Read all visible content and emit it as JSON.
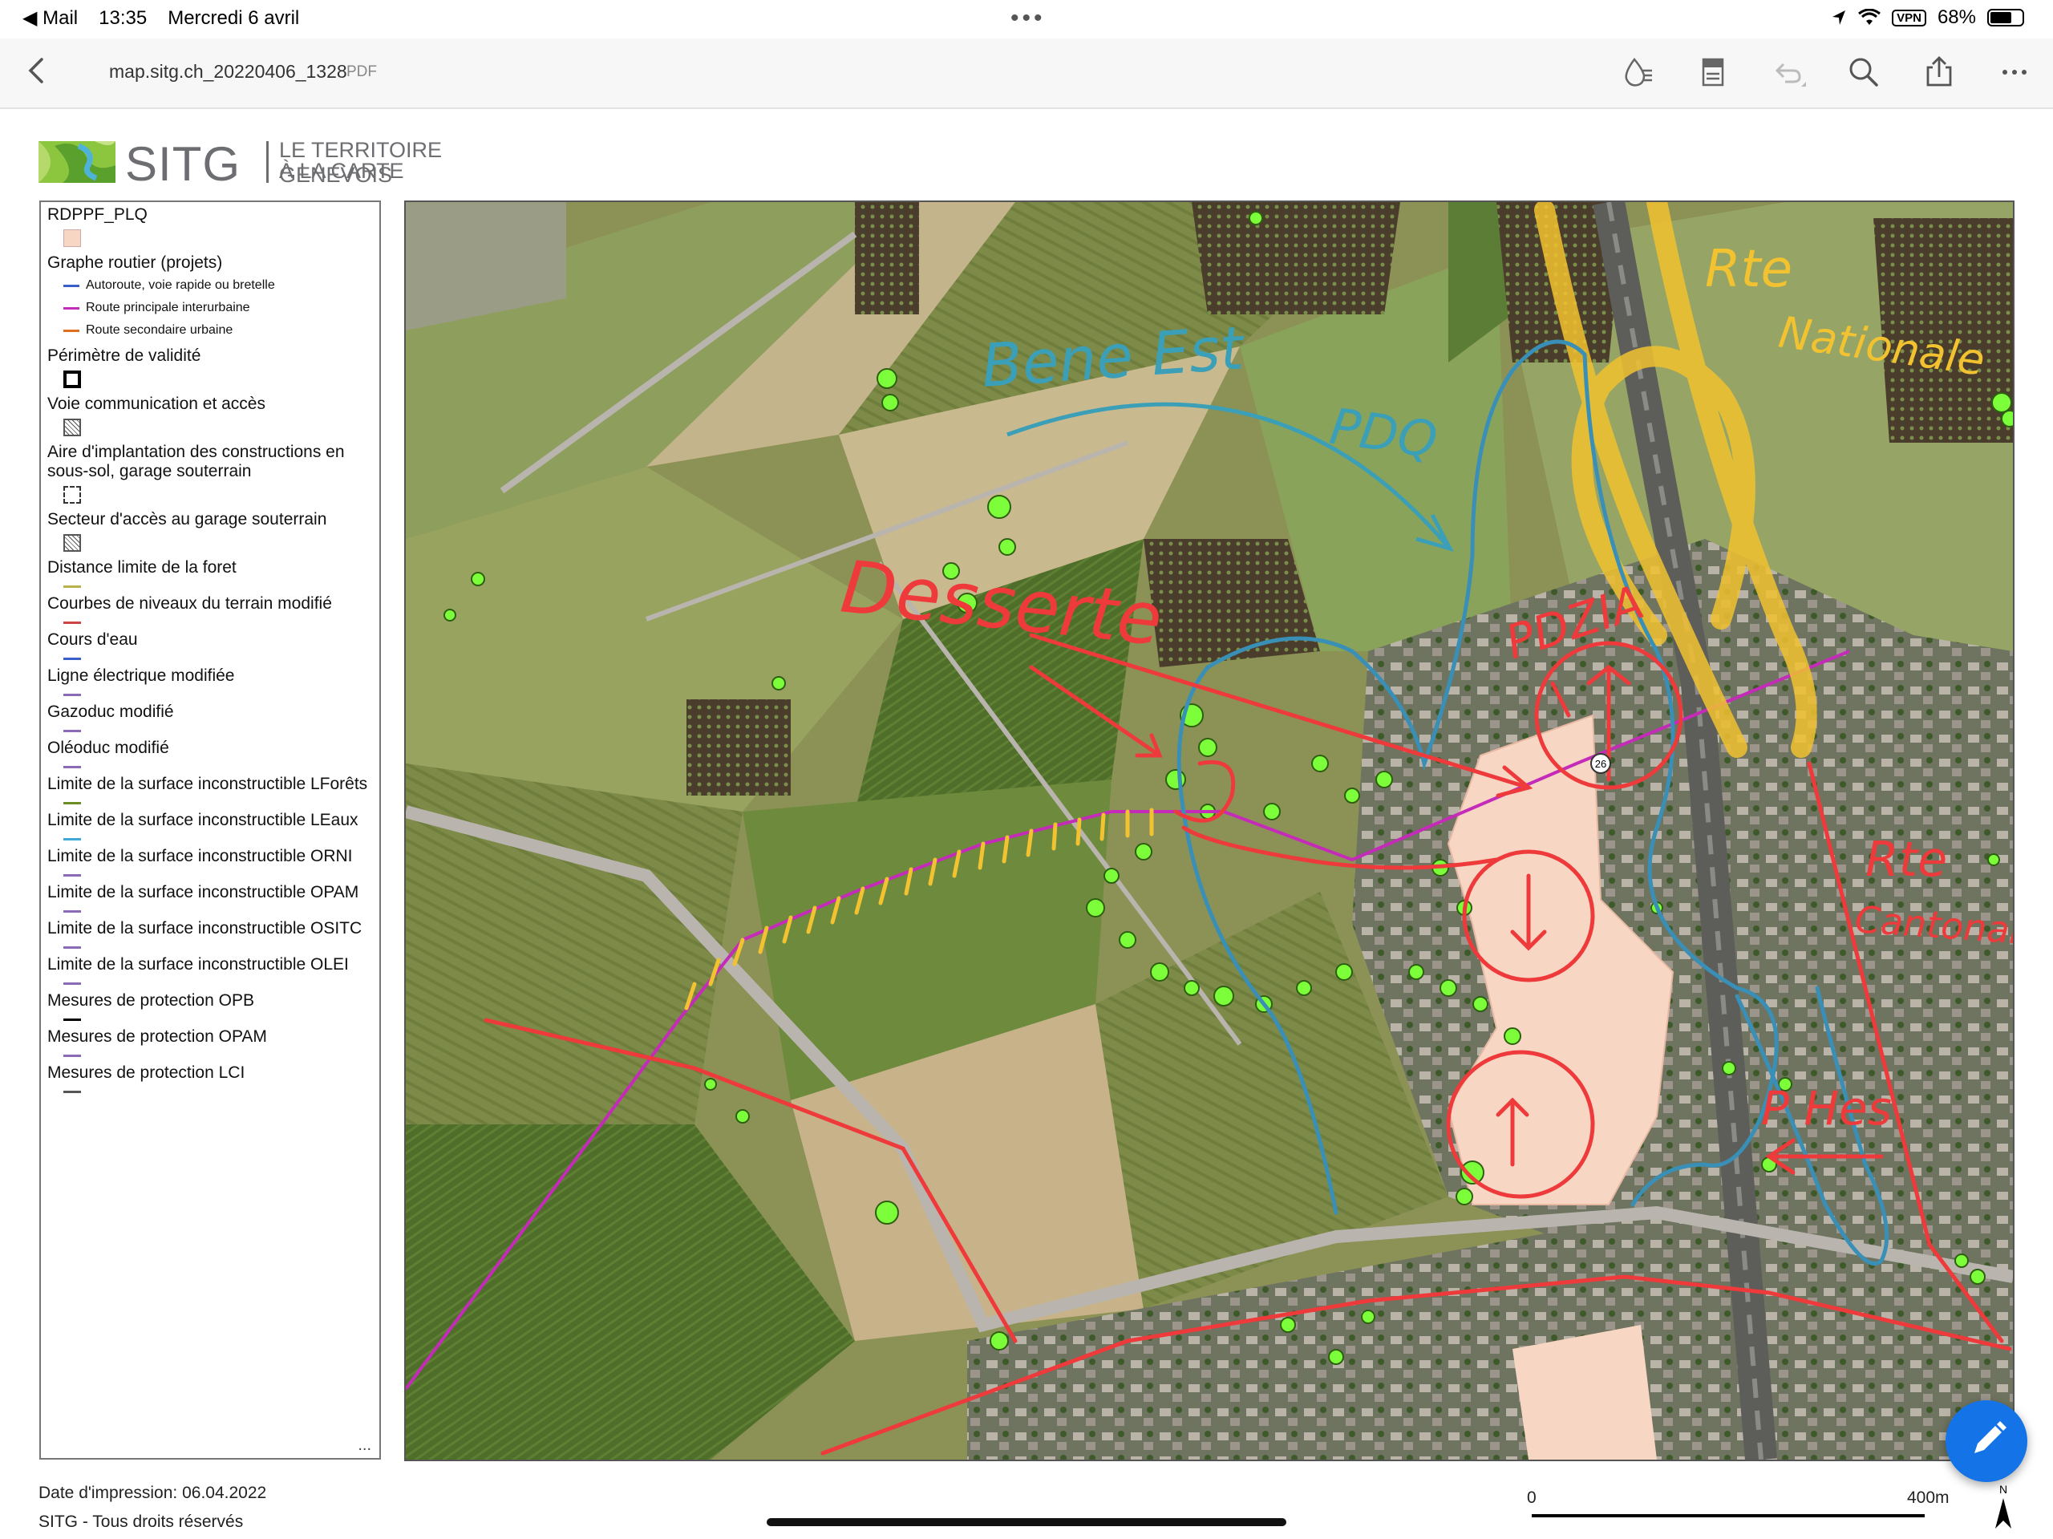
{
  "status_bar": {
    "back_app": "Mail",
    "time": "13:35",
    "date": "Mercredi 6 avril",
    "vpn": "VPN",
    "battery": "68%",
    "battery_level": 0.68
  },
  "toolbar": {
    "doc_title": "map.sitg.ch_20220406_1328",
    "doc_type": "PDF"
  },
  "header": {
    "logo_word": "SITG",
    "tagline_1": "LE TERRITOIRE GENEVOIS",
    "tagline_2": "À LA CARTE"
  },
  "legend": {
    "items": [
      {
        "label": "RDPPF_PLQ",
        "symbol": "swatch",
        "color": "#f7d6c4"
      },
      {
        "label": "Graphe routier (projets)",
        "symbol": "sublist",
        "sub": [
          {
            "label": "Autoroute, voie rapide ou bretelle",
            "color": "#3a5fcd"
          },
          {
            "label": "Route principale interurbaine",
            "color": "#c42bb8"
          },
          {
            "label": "Route secondaire urbaine",
            "color": "#e07020"
          }
        ]
      },
      {
        "label": "Périmètre de validité",
        "symbol": "box"
      },
      {
        "label": "Voie communication et accès",
        "symbol": "hatch"
      },
      {
        "label": "Aire d'implantation des constructions en sous-sol, garage souterrain",
        "symbol": "dash"
      },
      {
        "label": "Secteur d'accès au garage souterrain",
        "symbol": "hatch"
      },
      {
        "label": "Distance limite de la foret",
        "symbol": "line",
        "color": "#b9b24a"
      },
      {
        "label": "Courbes de niveaux du terrain modifié",
        "symbol": "line",
        "color": "#c44"
      },
      {
        "label": "Cours d'eau",
        "symbol": "line",
        "color": "#3a5fcd"
      },
      {
        "label": "Ligne électrique modifiée",
        "symbol": "line",
        "color": "#8b6bb5"
      },
      {
        "label": "Gazoduc modifié",
        "symbol": "line",
        "color": "#8b6bb5"
      },
      {
        "label": "Oléoduc modifié",
        "symbol": "line",
        "color": "#8b6bb5"
      },
      {
        "label": "Limite de la surface inconstructible LForêts",
        "symbol": "line",
        "color": "#6b8e23"
      },
      {
        "label": "Limite de la surface inconstructible LEaux",
        "symbol": "line",
        "color": "#3fa9d6"
      },
      {
        "label": "Limite de la surface inconstructible ORNI",
        "symbol": "line",
        "color": "#8b6bb5"
      },
      {
        "label": "Limite de la surface inconstructible OPAM",
        "symbol": "line",
        "color": "#8b6bb5"
      },
      {
        "label": "Limite de la surface inconstructible OSITC",
        "symbol": "line",
        "color": "#8b6bb5"
      },
      {
        "label": "Limite de la surface inconstructible OLEI",
        "symbol": "line",
        "color": "#8b6bb5"
      },
      {
        "label": "Mesures de protection OPB",
        "symbol": "line",
        "color": "#000000"
      },
      {
        "label": "Mesures de protection OPAM",
        "symbol": "line",
        "color": "#8b6bb5"
      },
      {
        "label": "Mesures de protection LCI",
        "symbol": "line",
        "color": "#555555"
      }
    ],
    "more": "..."
  },
  "map": {
    "annotations": {
      "blue_label_1": "Bene Est",
      "blue_label_2": "PDQ",
      "red_label_desserte": "Desserte",
      "red_label_pdzia": "PDZIA",
      "yellow_label_1": "Rte",
      "yellow_label_2": "Nationale",
      "red_label_rte": "Rte",
      "red_label_cantonale": "Cantonale",
      "red_label_pmes": "P Hes",
      "road_number": "26"
    },
    "colors": {
      "annotation_red": "#ee3a3a",
      "annotation_blue": "#3a8fb7",
      "annotation_yellow": "#f2c230",
      "route_magenta": "#c42bb8",
      "plq_area": "#f7d6c4",
      "tree_green": "#7cff3a"
    }
  },
  "footer": {
    "print_date": "Date d'impression: 06.04.2022",
    "rights": "SITG - Tous droits réservés",
    "scale_start": "0",
    "scale_end": "400m",
    "north": "N"
  }
}
